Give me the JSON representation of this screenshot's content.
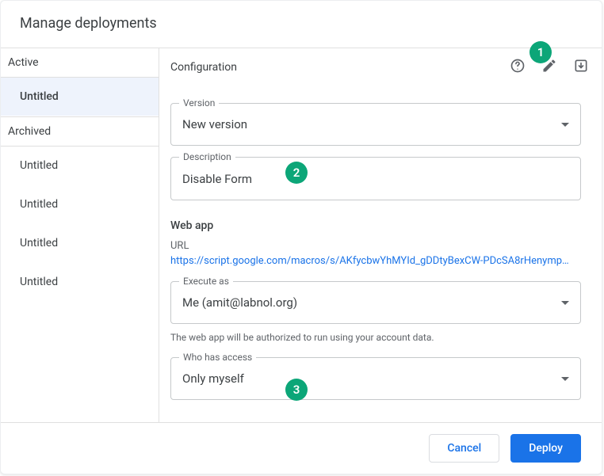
{
  "header": {
    "title": "Manage deployments"
  },
  "sidebar": {
    "active_label": "Active",
    "archived_label": "Archived",
    "active_items": [
      {
        "label": "Untitled"
      }
    ],
    "archived_items": [
      {
        "label": "Untitled"
      },
      {
        "label": "Untitled"
      },
      {
        "label": "Untitled"
      },
      {
        "label": "Untitled"
      }
    ]
  },
  "config": {
    "title": "Configuration",
    "version_label": "Version",
    "version_value": "New version",
    "description_label": "Description",
    "description_value": "Disable Form",
    "webapp_title": "Web app",
    "url_label": "URL",
    "url_value": "https://script.google.com/macros/s/AKfycbwYhMYId_gDDtyBexCW-PDcSA8rHenymp…",
    "execute_as_label": "Execute as",
    "execute_as_value": "Me (amit@labnol.org)",
    "auth_note": "The web app will be authorized to run using your account data.",
    "who_has_access_label": "Who has access",
    "who_has_access_value": "Only myself"
  },
  "footer": {
    "cancel_label": "Cancel",
    "deploy_label": "Deploy"
  },
  "annotations": {
    "one": "1",
    "two": "2",
    "three": "3"
  }
}
